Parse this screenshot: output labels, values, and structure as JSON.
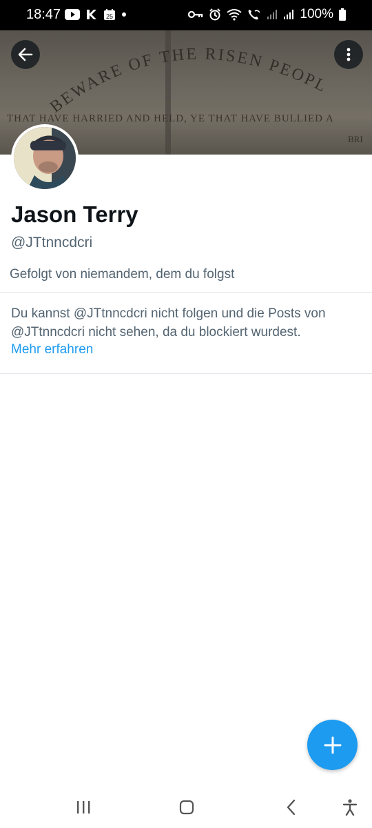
{
  "status_bar": {
    "time": "18:47",
    "battery": "100%",
    "calendar_day": "25",
    "left_icons": [
      "youtube-icon",
      "kick-icon",
      "calendar-icon",
      "dot-icon"
    ],
    "right_icons": [
      "vpn-key-icon",
      "alarm-icon",
      "wifi-icon",
      "wifi-call-icon",
      "signal-icon",
      "signal-icon",
      "battery-icon"
    ]
  },
  "header": {
    "banner_text_line1": "BEWARE OF THE RISEN PEOPLE",
    "banner_text_line2": "THAT HAVE HARRIED AND HELD, YE THAT HAVE BULLIED A",
    "banner_text_line3": "BRI"
  },
  "profile": {
    "display_name": "Jason Terry",
    "handle": "@JTtnncdcri",
    "followed_by": "Gefolgt von niemandem, dem du folgst"
  },
  "blocked_notice": {
    "message": "Du kannst @JTtnncdcri nicht folgen und die Posts von @JTtnncdcri nicht sehen, da du blockiert wurdest.",
    "learn_more": "Mehr erfahren"
  },
  "colors": {
    "accent": "#1d9bf0",
    "secondary_text": "#536471",
    "primary_text": "#0f1419"
  }
}
